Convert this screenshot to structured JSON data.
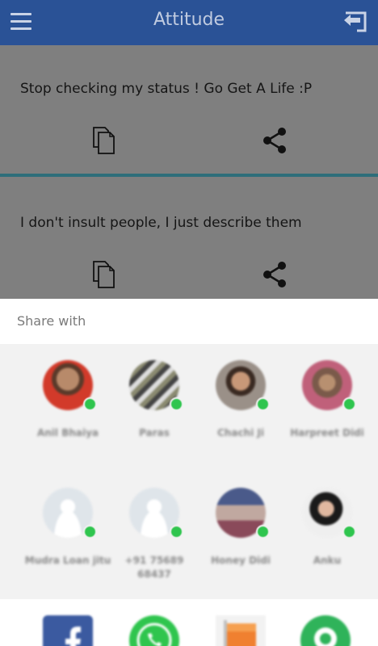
{
  "header": {
    "title": "Attitude",
    "background": "#2a5296"
  },
  "statuses": [
    {
      "text": "Stop checking my status ! Go Get A Life :P"
    },
    {
      "text": "I don't insult people, I just describe them"
    }
  ],
  "share_sheet": {
    "title": "Share with",
    "contacts": [
      {
        "name": "Anil Bhaiya"
      },
      {
        "name": "Paras"
      },
      {
        "name": "Chachi Ji"
      },
      {
        "name": "Harpreet Didi"
      },
      {
        "name": "Mudra Loan jitu"
      },
      {
        "name": "+91 75689 68437"
      },
      {
        "name": "Honey Didi"
      },
      {
        "name": "Anku"
      }
    ],
    "apps": [
      {
        "icon": "facebook-icon"
      },
      {
        "icon": "whatsapp-icon"
      },
      {
        "icon": "app-flag-icon"
      },
      {
        "icon": "hangouts-icon"
      }
    ],
    "badge_color": "#2fc54e"
  }
}
